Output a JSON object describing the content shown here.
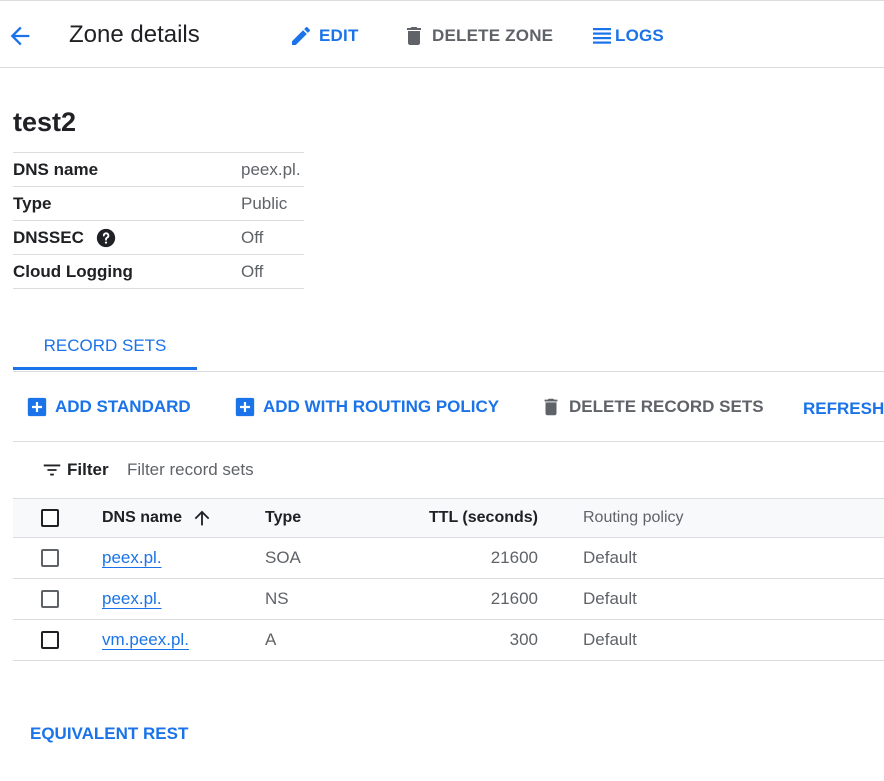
{
  "header": {
    "title": "Zone details",
    "edit_label": "EDIT",
    "delete_label": "DELETE ZONE",
    "logs_label": "LOGS"
  },
  "zone": {
    "name": "test2",
    "details": [
      {
        "key": "DNS name",
        "value": "peex.pl."
      },
      {
        "key": "Type",
        "value": "Public"
      },
      {
        "key": "DNSSEC",
        "value": "Off"
      },
      {
        "key": "Cloud Logging",
        "value": "Off"
      }
    ]
  },
  "tabs": [
    {
      "label": "RECORD SETS"
    }
  ],
  "actions": {
    "add_standard": "ADD STANDARD",
    "add_routing": "ADD WITH ROUTING POLICY",
    "delete_record_sets": "DELETE RECORD SETS",
    "refresh": "REFRESH"
  },
  "filter": {
    "label": "Filter",
    "placeholder": "Filter record sets"
  },
  "table": {
    "columns": [
      "DNS name",
      "Type",
      "TTL (seconds)",
      "Routing policy"
    ],
    "rows": [
      {
        "dns": "peex.pl.",
        "type": "SOA",
        "ttl": "21600",
        "routing": "Default"
      },
      {
        "dns": "peex.pl.",
        "type": "NS",
        "ttl": "21600",
        "routing": "Default"
      },
      {
        "dns": "vm.peex.pl.",
        "type": "A",
        "ttl": "300",
        "routing": "Default"
      }
    ]
  },
  "footer": {
    "equivalent_rest": "EQUIVALENT REST"
  },
  "colors": {
    "accent": "#1a73e8",
    "muted": "#5f6368",
    "divider": "#dadce0"
  },
  "icons": [
    "arrow-back-icon",
    "edit-pencil-icon",
    "trash-icon",
    "logs-icon",
    "help-circle-icon",
    "add-box-icon",
    "refresh-icon",
    "filter-icon",
    "sort-arrow-up-icon"
  ]
}
